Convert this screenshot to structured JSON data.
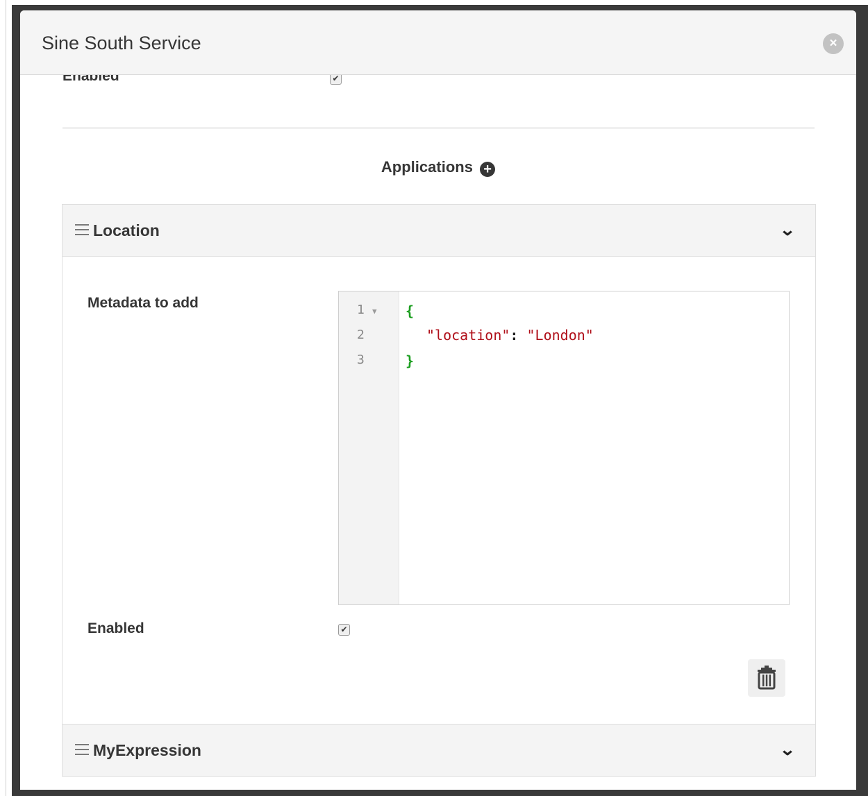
{
  "modal": {
    "title": "Sine South Service",
    "close_icon": "×"
  },
  "top_field": {
    "label": "Enabled",
    "checked": true
  },
  "applications": {
    "title": "Applications",
    "add_icon": "+",
    "items": [
      {
        "name": "Location",
        "expanded": true,
        "metadata_label": "Metadata to add",
        "editor": {
          "line_numbers": [
            "1",
            "2",
            "3"
          ],
          "lines": {
            "open": "{",
            "key": "\"location\"",
            "colon": ":",
            "value": "\"London\"",
            "close": "}"
          }
        },
        "enabled_label": "Enabled",
        "enabled": true
      },
      {
        "name": "MyExpression",
        "expanded": false
      }
    ]
  },
  "icons": {
    "chevron": "⌄",
    "check": "✔"
  }
}
